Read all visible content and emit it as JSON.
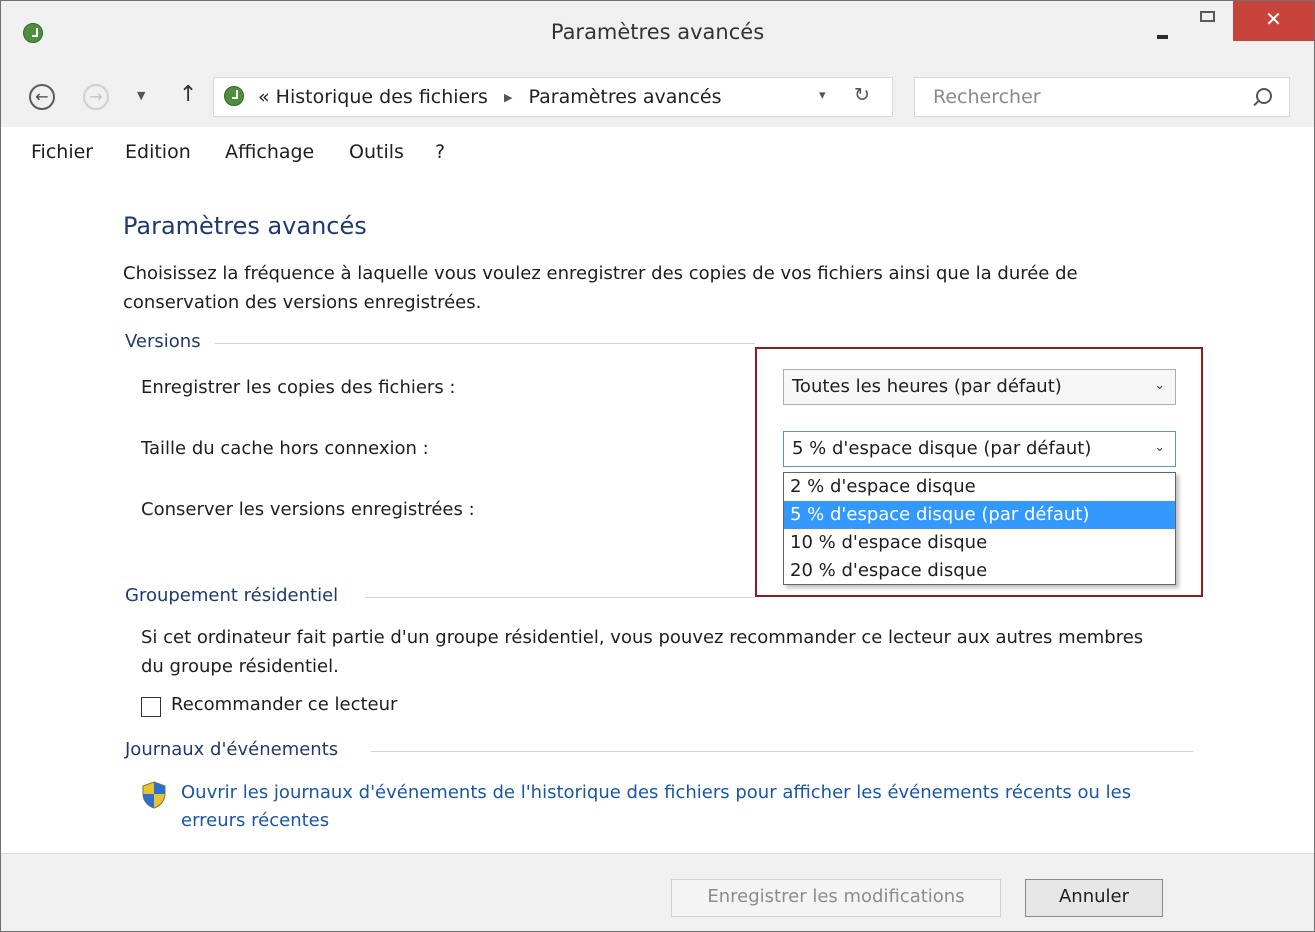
{
  "window": {
    "title": "Paramètres avancés",
    "close_glyph": "✕",
    "icon": "file-history-icon"
  },
  "nav": {
    "back_glyph": "←",
    "forward_glyph": "→",
    "recent_glyph": "▼",
    "up_glyph": "↑",
    "breadcrumb_prefix": "«",
    "breadcrumb": [
      "Historique des fichiers",
      "Paramètres avancés"
    ],
    "breadcrumb_sep": "▶",
    "dropdown_glyph": "▾",
    "refresh_glyph": "↻",
    "search_placeholder": "Rechercher"
  },
  "menu": [
    "Fichier",
    "Edition",
    "Affichage",
    "Outils",
    "?"
  ],
  "page": {
    "heading": "Paramètres avancés",
    "description": "Choisissez la fréquence à laquelle vous voulez enregistrer des copies de vos fichiers ainsi que la durée de conservation des versions enregistrées."
  },
  "versions": {
    "group_title": "Versions",
    "save_copies_label": "Enregistrer les copies des fichiers :",
    "save_copies_value": "Toutes les heures (par défaut)",
    "cache_size_label": "Taille du cache hors connexion :",
    "cache_size_value": "5 % d'espace disque (par défaut)",
    "keep_versions_label": "Conserver les versions enregistrées :",
    "combo_arrow": "⌄",
    "cache_options": [
      "2 % d'espace disque",
      "5 % d'espace disque (par défaut)",
      "10 % d'espace disque",
      "20 % d'espace disque"
    ],
    "selected_option_index": 1
  },
  "homegroup": {
    "group_title": "Groupement résidentiel",
    "text": "Si cet ordinateur fait partie d'un groupe résidentiel, vous pouvez recommander ce lecteur aux autres membres du groupe résidentiel.",
    "checkbox_label": "Recommander ce lecteur",
    "checked": false
  },
  "events": {
    "group_title": "Journaux d'événements",
    "link_text": "Ouvrir les journaux d'événements de l'historique des fichiers pour afficher les événements récents ou les erreurs récentes"
  },
  "footer": {
    "save_label": "Enregistrer les modifications",
    "cancel_label": "Annuler"
  },
  "colors": {
    "heading": "#1e3a6e",
    "link": "#1a56a6",
    "selection": "#3399ff",
    "highlight_border": "#8c1d1d",
    "close_button": "#c8433b"
  }
}
